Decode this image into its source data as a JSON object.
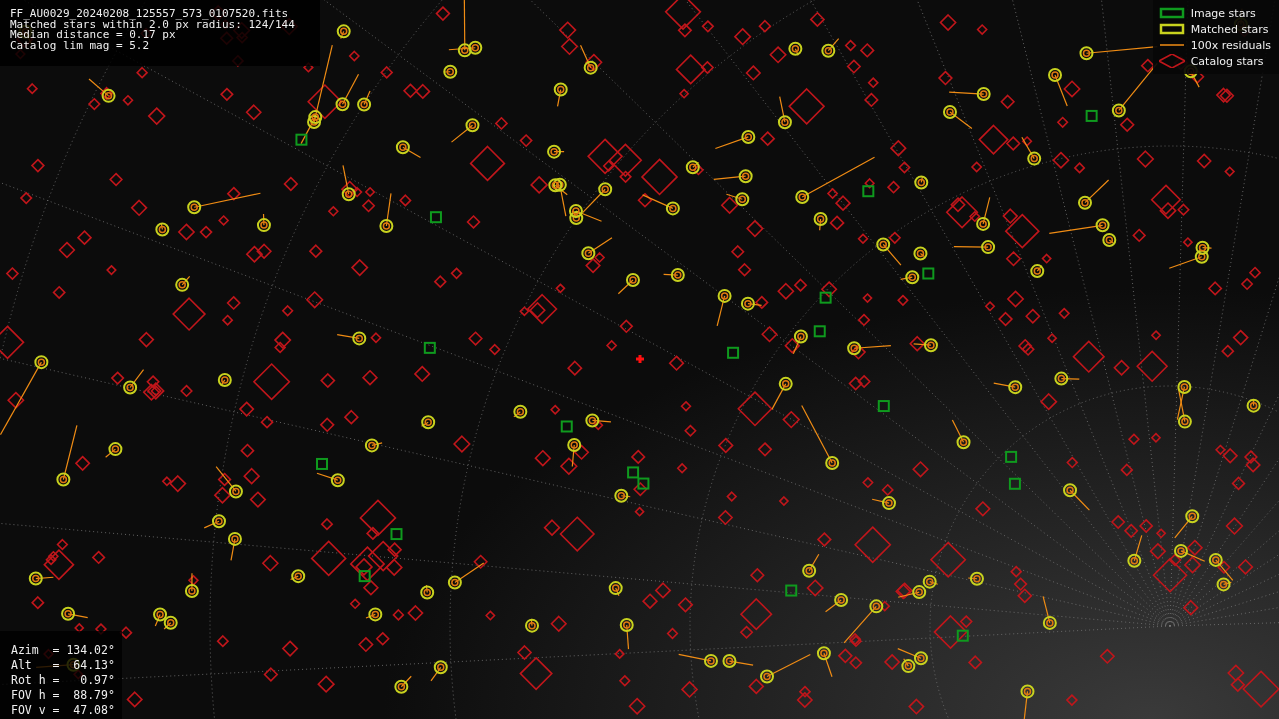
{
  "info": {
    "lines": [
      "FF_AU0029_20240208_125557_573_0107520.fits",
      "Matched stars within 2.0 px radius: 124/144",
      "Median distance = 0.17 px",
      "Catalog lim mag = 5.2"
    ]
  },
  "legend": [
    {
      "kind": "image",
      "label": "Image stars"
    },
    {
      "kind": "matched",
      "label": "Matched stars"
    },
    {
      "kind": "residual",
      "label": "100x residuals"
    },
    {
      "kind": "catalog",
      "label": "Catalog stars"
    }
  ],
  "pointing": {
    "lines": [
      "Azim  = 134.02°",
      "Alt   =  64.13°",
      "Rot h =   0.97°",
      "FOV h =  88.79°",
      "FOV v =  47.08°"
    ]
  }
}
